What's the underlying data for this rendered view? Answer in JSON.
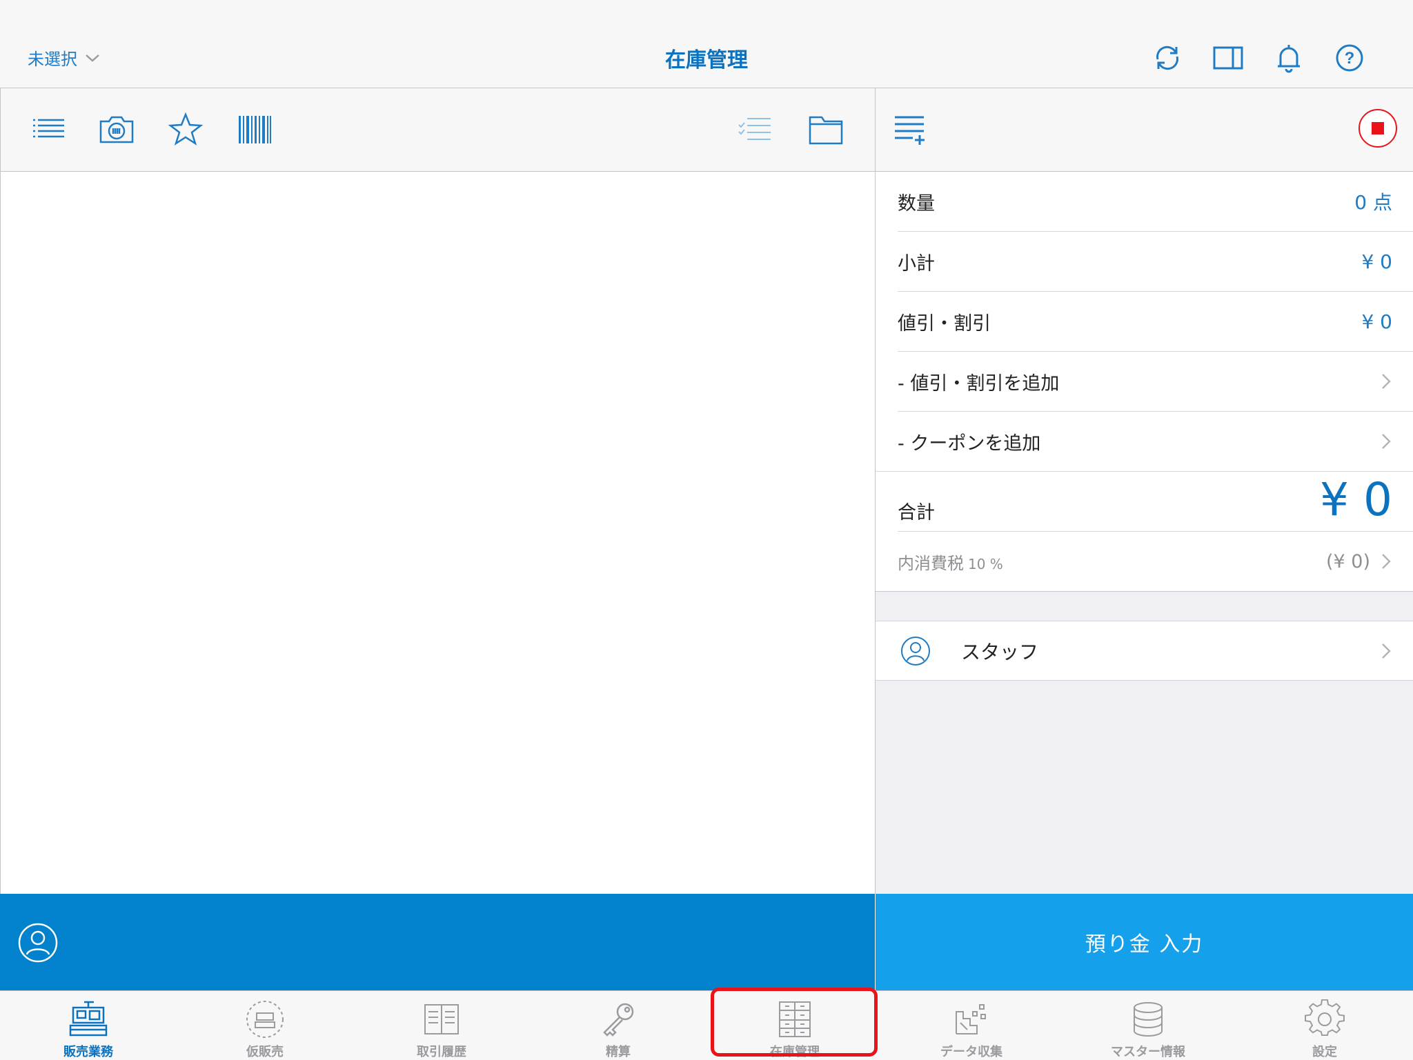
{
  "header": {
    "store_selector": "未選択",
    "title": "在庫管理",
    "icons": [
      "sync-icon",
      "split-view-icon",
      "bell-icon",
      "help-icon"
    ]
  },
  "left_toolbar": {
    "icons": [
      "list-icon",
      "camera-icon",
      "star-icon",
      "barcode-icon",
      "checklist-icon",
      "folder-icon"
    ]
  },
  "right_toolbar": {
    "icons": [
      "add-item-list-icon",
      "stop-record-icon"
    ]
  },
  "summary": {
    "quantity_label": "数量",
    "quantity_value": "0 点",
    "subtotal_label": "小計",
    "subtotal_value": "¥ 0",
    "discount_label": "値引・割引",
    "discount_value": "¥ 0",
    "add_discount_label": "- 値引・割引を追加",
    "add_coupon_label": "- クーポンを追加",
    "total_label": "合計",
    "total_value": "¥ 0",
    "tax_label": "内消費税",
    "tax_rate": "10 %",
    "tax_value": "(¥ 0)"
  },
  "staff": {
    "label": "スタッフ"
  },
  "deposit_button": "預り金 入力",
  "tabs": [
    {
      "label": "販売業務",
      "icon": "register-icon",
      "active": true
    },
    {
      "label": "仮販売",
      "icon": "temporary-register-icon",
      "active": false
    },
    {
      "label": "取引履歴",
      "icon": "ledger-icon",
      "active": false
    },
    {
      "label": "精算",
      "icon": "key-icon",
      "active": false
    },
    {
      "label": "在庫管理",
      "icon": "inventory-cabinet-icon",
      "active": false
    },
    {
      "label": "データ収集",
      "icon": "data-collection-icon",
      "active": false
    },
    {
      "label": "マスター情報",
      "icon": "database-icon",
      "active": false
    },
    {
      "label": "設定",
      "icon": "gear-icon",
      "active": false
    }
  ],
  "colors": {
    "accent": "#0a72be",
    "footer_blue": "#0281cc",
    "button_blue": "#15a0ec",
    "highlight": "#e8141a",
    "record_red": "#e8141a"
  }
}
